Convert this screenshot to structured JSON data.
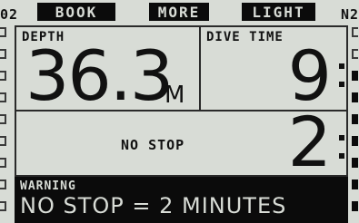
{
  "topbar": {
    "left_indicator": "02",
    "right_indicator": "N2",
    "softkeys": {
      "book": "BOOK",
      "more": "MORE",
      "light": "LIGHT"
    }
  },
  "depth": {
    "label": "DEPTH",
    "value": "36.3",
    "unit": "M"
  },
  "dive_time": {
    "label": "DIVE TIME",
    "minutes": "9"
  },
  "no_stop": {
    "label": "NO STOP",
    "minutes": "2"
  },
  "warning": {
    "title": "WARNING",
    "message": "NO STOP = 2 MINUTES"
  },
  "colors": {
    "background": "#d8dcd6",
    "foreground": "#0b0b0b"
  }
}
